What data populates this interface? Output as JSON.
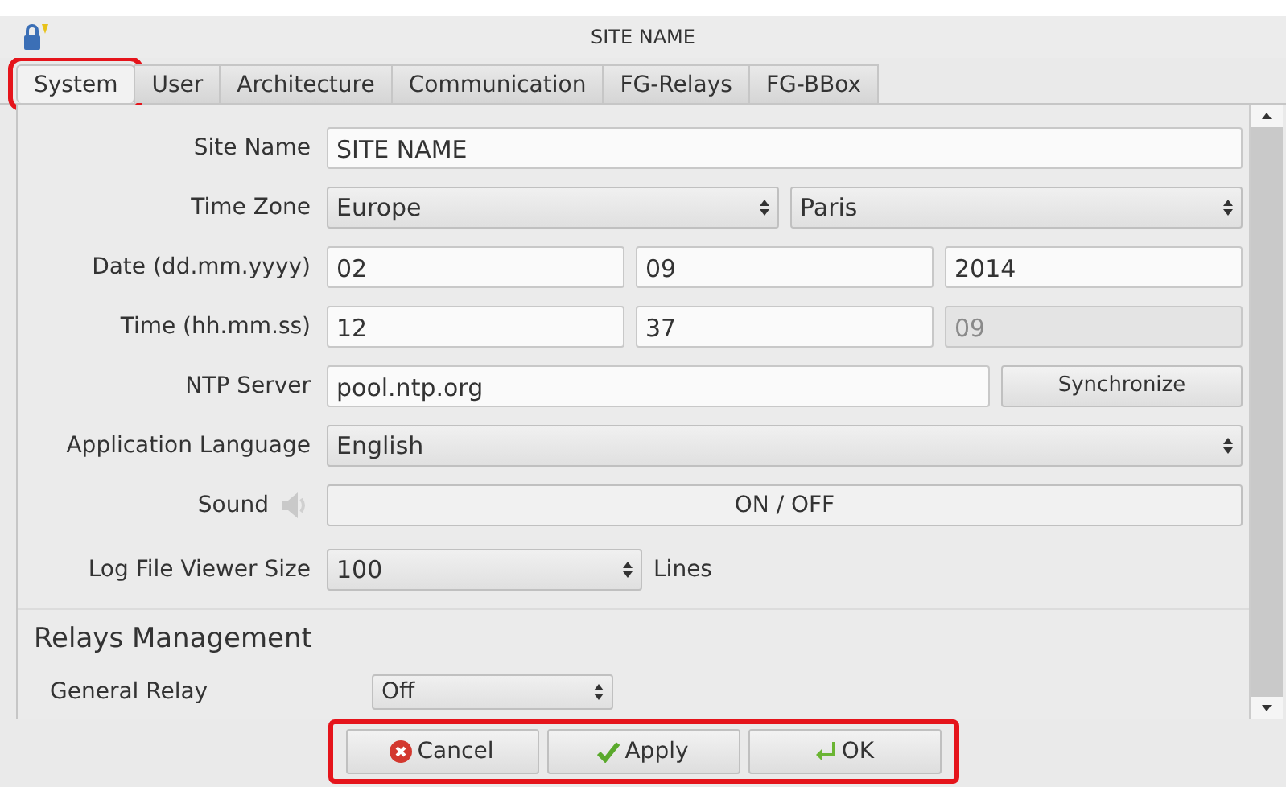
{
  "window": {
    "title": "SITE NAME"
  },
  "tabs": [
    {
      "label": "System",
      "selected": true,
      "highlighted": true
    },
    {
      "label": "User",
      "selected": false,
      "highlighted": false
    },
    {
      "label": "Architecture",
      "selected": false,
      "highlighted": false
    },
    {
      "label": "Communication",
      "selected": false,
      "highlighted": false
    },
    {
      "label": "FG-Relays",
      "selected": false,
      "highlighted": false
    },
    {
      "label": "FG-BBox",
      "selected": false,
      "highlighted": false
    }
  ],
  "rows": [
    {
      "kind": "text",
      "label": "Site Name",
      "fields": [
        {
          "value": "SITE NAME",
          "disabled": false
        }
      ]
    },
    {
      "kind": "selects",
      "label": "Time Zone",
      "fields": [
        {
          "value": "Europe"
        },
        {
          "value": "Paris"
        }
      ]
    },
    {
      "kind": "text",
      "label": "Date (dd.mm.yyyy)",
      "fields": [
        {
          "value": "02",
          "disabled": false
        },
        {
          "value": "09",
          "disabled": false
        },
        {
          "value": "2014",
          "disabled": false
        }
      ]
    },
    {
      "kind": "text",
      "label": "Time (hh.mm.ss)",
      "fields": [
        {
          "value": "12",
          "disabled": false
        },
        {
          "value": "37",
          "disabled": false
        },
        {
          "value": "09",
          "disabled": true
        }
      ]
    },
    {
      "kind": "text-button",
      "label": "NTP Server",
      "fields": [
        {
          "value": "pool.ntp.org",
          "disabled": false
        }
      ],
      "button": "Synchronize"
    },
    {
      "kind": "selects",
      "label": "Application Language",
      "fields": [
        {
          "value": "English"
        }
      ]
    },
    {
      "kind": "toggle",
      "label": "Sound",
      "button": "ON / OFF"
    },
    {
      "kind": "select-unit",
      "label": "Log File Viewer Size",
      "fields": [
        {
          "value": "100"
        }
      ],
      "unit": "Lines"
    }
  ],
  "section": {
    "title": "Relays Management",
    "rows": [
      {
        "label": "General Relay",
        "value": "Off"
      }
    ]
  },
  "footer": {
    "highlighted": true,
    "buttons": [
      {
        "kind": "cancel",
        "label": "Cancel"
      },
      {
        "kind": "apply",
        "label": "Apply"
      },
      {
        "kind": "ok",
        "label": "OK"
      }
    ]
  }
}
